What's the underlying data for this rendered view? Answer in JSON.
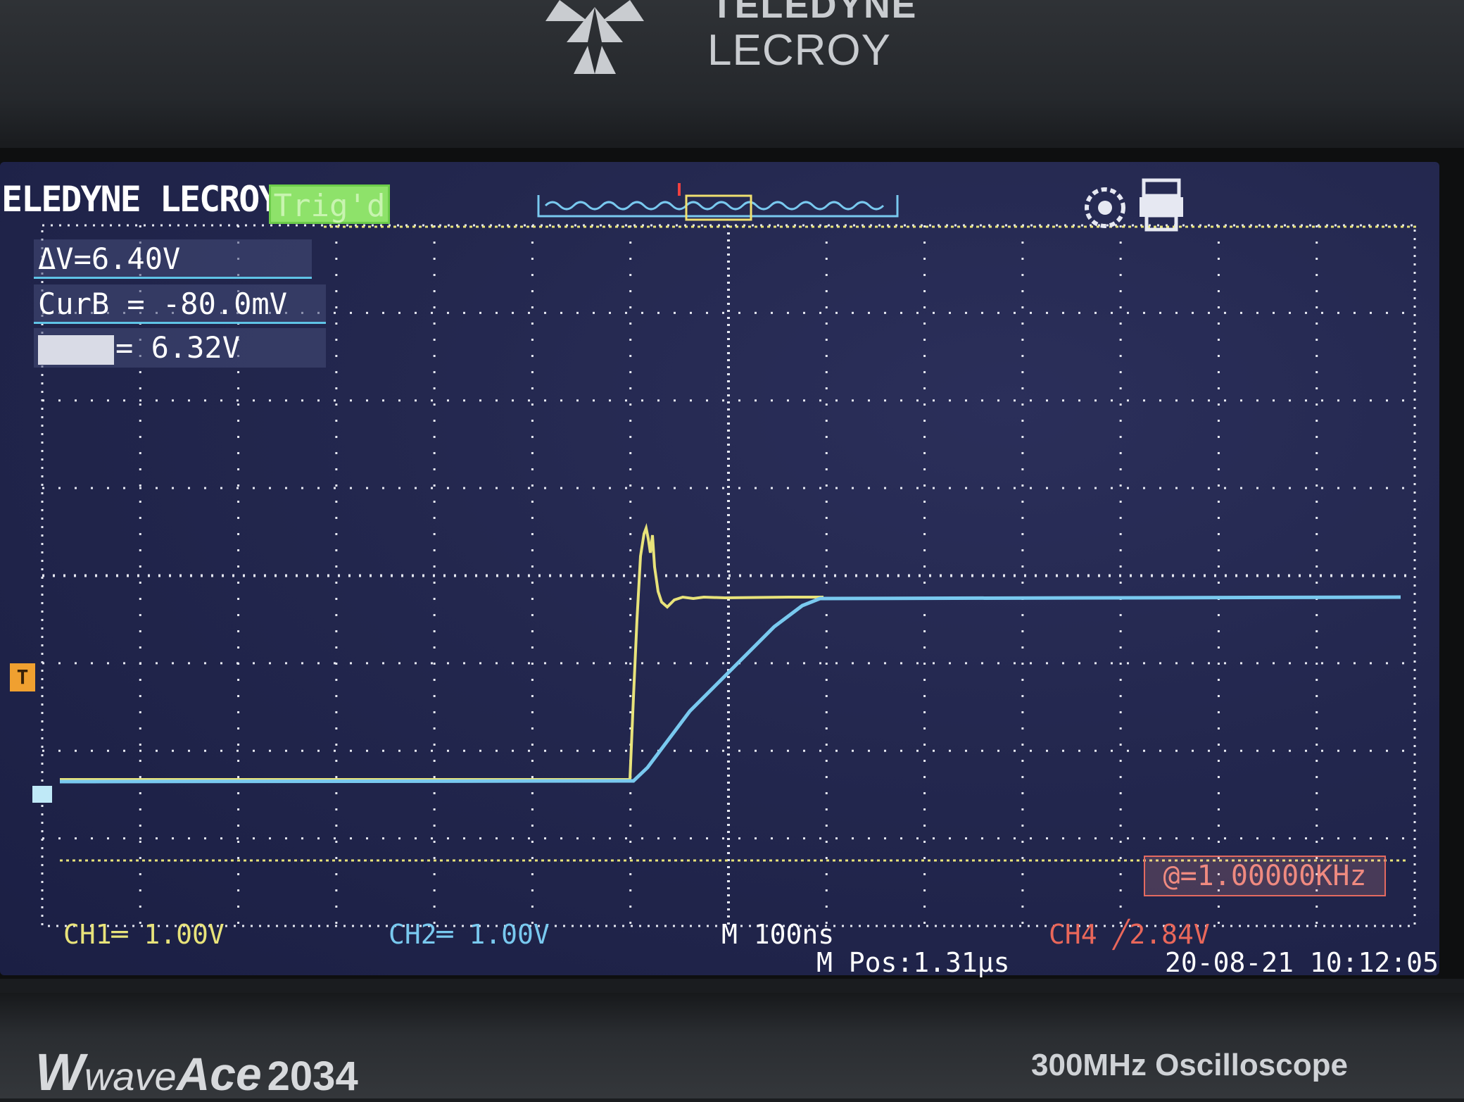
{
  "device": {
    "brand_line1": "TELEDYNE",
    "brand_line2": "LECROY",
    "model_w": "W",
    "model_wave": "wave",
    "model_ace": "Ace",
    "model_number": "2034",
    "model_description": "300MHz Oscilloscope"
  },
  "header": {
    "brand": "ELEDYNE LECROY",
    "trigger_status": "Trig'd"
  },
  "cursors": {
    "delta_v": "ΔV=6.40V",
    "cur_b": "CurB = -80.0mV",
    "cur_a_value": "= 6.32V"
  },
  "frequency": "@=1.00000KHz",
  "trigger_marker": "T",
  "footer": {
    "ch1": "CH1═ 1.00V",
    "ch2": "CH2═ 1.00V",
    "timebase": "M 100ns",
    "ch4_trigger": "CH4 ╱2.84V",
    "m_pos": "M Pos:1.31μs",
    "datetime": "20-08-21 10:12:05"
  },
  "colors": {
    "ch1": "#e8e37a",
    "ch2": "#79c9ef",
    "ch4": "#e9675a",
    "grid": "#e6e8f2",
    "screen_bg": "#23274e"
  },
  "icons": {
    "logo": "teledyne-logo-icon",
    "status_1": "gear-icon",
    "status_2": "printer-icon"
  }
}
